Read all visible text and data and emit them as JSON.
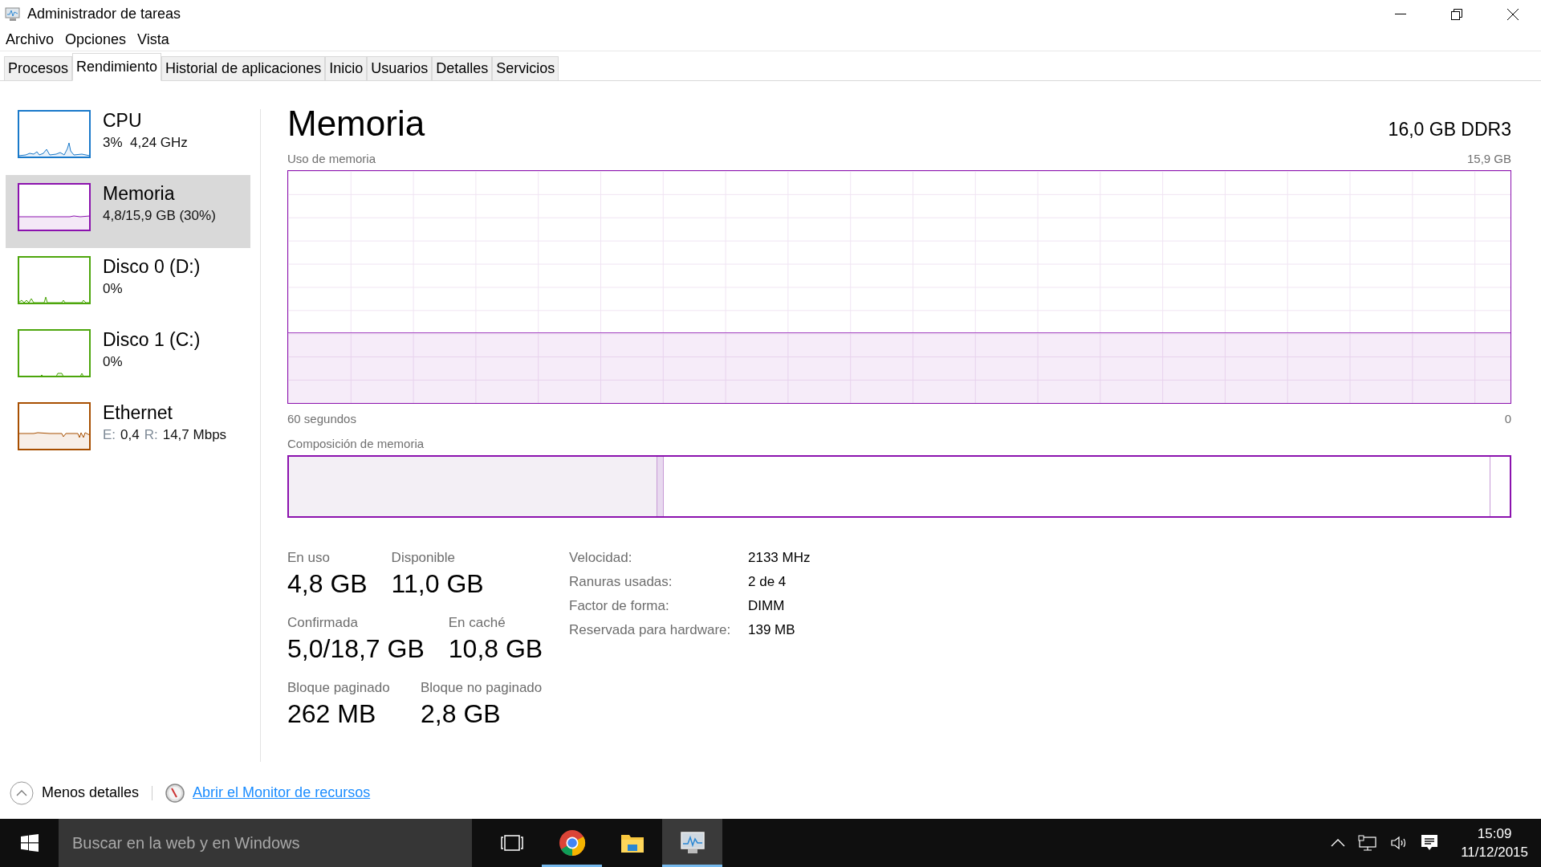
{
  "window": {
    "title": "Administrador de tareas"
  },
  "menu": [
    "Archivo",
    "Opciones",
    "Vista"
  ],
  "tabs": [
    {
      "label": "Procesos",
      "selected": false
    },
    {
      "label": "Rendimiento",
      "selected": true
    },
    {
      "label": "Historial de aplicaciones",
      "selected": false
    },
    {
      "label": "Inicio",
      "selected": false
    },
    {
      "label": "Usuarios",
      "selected": false
    },
    {
      "label": "Detalles",
      "selected": false
    },
    {
      "label": "Servicios",
      "selected": false
    }
  ],
  "sidebar": {
    "items": [
      {
        "title": "CPU",
        "subtitle": "3%  4,24 GHz",
        "color": "#1979ca",
        "selected": false
      },
      {
        "title": "Memoria",
        "subtitle": "4,8/15,9 GB (30%)",
        "color": "#8b12ae",
        "selected": true
      },
      {
        "title": "Disco 0 (D:)",
        "subtitle": "0%",
        "color": "#4da60c",
        "selected": false
      },
      {
        "title": "Disco 1 (C:)",
        "subtitle": "0%",
        "color": "#4da60c",
        "selected": false
      },
      {
        "title": "Ethernet",
        "subtitle_parts": [
          {
            "label": "E:",
            "value": "0,4"
          },
          {
            "label": "R:",
            "value": "14,7 Mbps"
          }
        ],
        "color": "#a74f01",
        "selected": false
      }
    ]
  },
  "main": {
    "title": "Memoria",
    "spec": "16,0 GB DDR3",
    "usage_graph": {
      "label": "Uso de memoria",
      "max": "15,9 GB",
      "left_axis": "60 segundos",
      "right_axis": "0"
    },
    "composition": {
      "label": "Composición de memoria"
    },
    "stats": [
      [
        {
          "label": "En uso",
          "value": "4,8 GB"
        },
        {
          "label": "Disponible",
          "value": "11,0 GB"
        }
      ],
      [
        {
          "label": "Confirmada",
          "value": "5,0/18,7 GB"
        },
        {
          "label": "En caché",
          "value": "10,8 GB"
        }
      ],
      [
        {
          "label": "Bloque paginado",
          "value": "262 MB"
        },
        {
          "label": "Bloque no paginado",
          "value": "2,8 GB"
        }
      ]
    ],
    "details": [
      {
        "label": "Velocidad:",
        "value": "2133 MHz"
      },
      {
        "label": "Ranuras usadas:",
        "value": "2 de 4"
      },
      {
        "label": "Factor de forma:",
        "value": "DIMM"
      },
      {
        "label": "Reservada para hardware:",
        "value": "139 MB"
      }
    ]
  },
  "footer": {
    "less_details": "Menos detalles",
    "link": "Abrir el Monitor de recursos"
  },
  "taskbar": {
    "search_placeholder": "Buscar en la web y en Windows",
    "apps": [
      {
        "kind": "taskview",
        "running": false,
        "selected": false
      },
      {
        "kind": "browser",
        "running": true,
        "selected": false
      },
      {
        "kind": "folder",
        "running": false,
        "selected": false
      },
      {
        "kind": "taskmanager",
        "running": true,
        "selected": true
      }
    ],
    "time": "15:09",
    "date": "11/12/2015"
  }
}
